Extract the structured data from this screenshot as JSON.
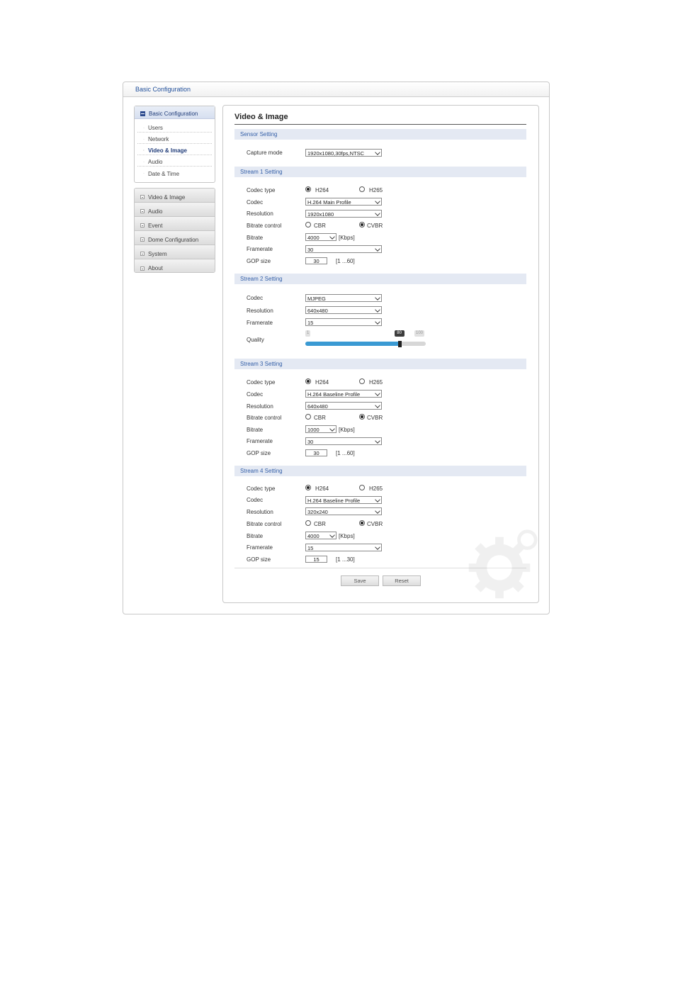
{
  "window": {
    "title": "Basic Configuration"
  },
  "sidebar": {
    "open_section": "Basic Configuration",
    "sub_items": [
      {
        "label": "Users",
        "active": false
      },
      {
        "label": "Network",
        "active": false
      },
      {
        "label": "Video & Image",
        "active": true
      },
      {
        "label": "Audio",
        "active": false
      },
      {
        "label": "Date & Time",
        "active": false
      }
    ],
    "menu_items": [
      "Video & Image",
      "Audio",
      "Event",
      "Dome Configuration",
      "System",
      "About"
    ]
  },
  "main": {
    "title": "Video & Image",
    "sensor": {
      "heading": "Sensor Setting",
      "capture_mode_label": "Capture mode",
      "capture_mode_value": "1920x1080,30fps,NTSC"
    },
    "stream1": {
      "heading": "Stream 1 Setting",
      "codec_type_label": "Codec type",
      "h264_label": "H264",
      "h265_label": "H265",
      "codec_type": "H264",
      "codec_label": "Codec",
      "codec_value": "H.264 Main Profile",
      "resolution_label": "Resolution",
      "resolution_value": "1920x1080",
      "bitrate_control_label": "Bitrate control",
      "cbr_label": "CBR",
      "cvbr_label": "CVBR",
      "bitrate_control": "CVBR",
      "bitrate_label": "Bitrate",
      "bitrate_value": "4000",
      "bitrate_unit": "[Kbps]",
      "framerate_label": "Framerate",
      "framerate_value": "30",
      "gop_label": "GOP size",
      "gop_value": "30",
      "gop_range": "[1 ...60]"
    },
    "stream2": {
      "heading": "Stream 2 Setting",
      "codec_label": "Codec",
      "codec_value": "MJPEG",
      "resolution_label": "Resolution",
      "resolution_value": "640x480",
      "framerate_label": "Framerate",
      "framerate_value": "15",
      "quality_label": "Quality",
      "quality_min": "1",
      "quality_max": "100",
      "quality_value": "80",
      "quality_fraction": 0.78
    },
    "stream3": {
      "heading": "Stream 3 Setting",
      "codec_type_label": "Codec type",
      "h264_label": "H264",
      "h265_label": "H265",
      "codec_type": "H264",
      "codec_label": "Codec",
      "codec_value": "H.264 Baseline Profile",
      "resolution_label": "Resolution",
      "resolution_value": "640x480",
      "bitrate_control_label": "Bitrate control",
      "cbr_label": "CBR",
      "cvbr_label": "CVBR",
      "bitrate_control": "CVBR",
      "bitrate_label": "Bitrate",
      "bitrate_value": "1000",
      "bitrate_unit": "[Kbps]",
      "framerate_label": "Framerate",
      "framerate_value": "30",
      "gop_label": "GOP size",
      "gop_value": "30",
      "gop_range": "[1 ...60]"
    },
    "stream4": {
      "heading": "Stream 4 Setting",
      "codec_type_label": "Codec type",
      "h264_label": "H264",
      "h265_label": "H265",
      "codec_type": "H264",
      "codec_label": "Codec",
      "codec_value": "H.264 Baseline Profile",
      "resolution_label": "Resolution",
      "resolution_value": "320x240",
      "bitrate_control_label": "Bitrate control",
      "cbr_label": "CBR",
      "cvbr_label": "CVBR",
      "bitrate_control": "CVBR",
      "bitrate_label": "Bitrate",
      "bitrate_value": "4000",
      "bitrate_unit": "[Kbps]",
      "framerate_label": "Framerate",
      "framerate_value": "15",
      "gop_label": "GOP size",
      "gop_value": "15",
      "gop_range": "[1 ...30]"
    },
    "buttons": {
      "save": "Save",
      "reset": "Reset"
    }
  },
  "icons": {
    "section_open": "minus-box-icon",
    "section_closed": "plus-box-icon",
    "watermark": "gear-icon"
  }
}
